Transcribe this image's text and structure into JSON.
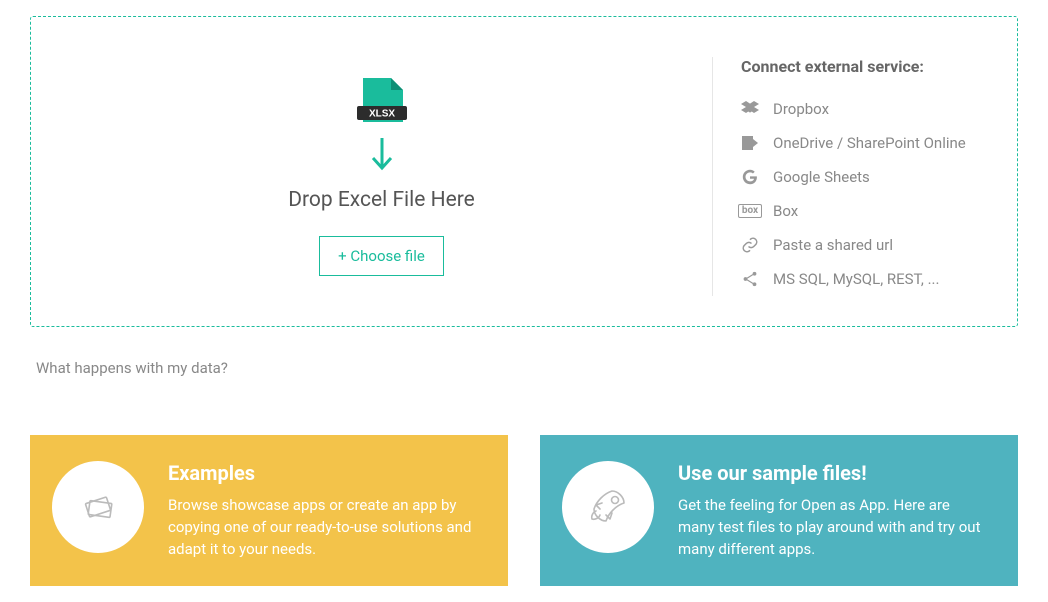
{
  "drop": {
    "title": "Drop Excel File Here",
    "choose_label": "+ Choose file",
    "file_tag": "XLSX"
  },
  "services": {
    "title": "Connect external service:",
    "items": [
      {
        "label": "Dropbox"
      },
      {
        "label": "OneDrive / SharePoint Online"
      },
      {
        "label": "Google Sheets"
      },
      {
        "label": "Box"
      },
      {
        "label": "Paste a shared url"
      },
      {
        "label": "MS SQL, MySQL, REST, ..."
      }
    ]
  },
  "data_question": "What happens with my data?",
  "cards": {
    "examples": {
      "title": "Examples",
      "body": "Browse showcase apps or create an app by copying one of our ready-to-use solutions and adapt it to your needs."
    },
    "samples": {
      "title": "Use our sample files!",
      "body": "Get the feeling for Open as App. Here are many test files to play around with and try out many different apps."
    }
  }
}
